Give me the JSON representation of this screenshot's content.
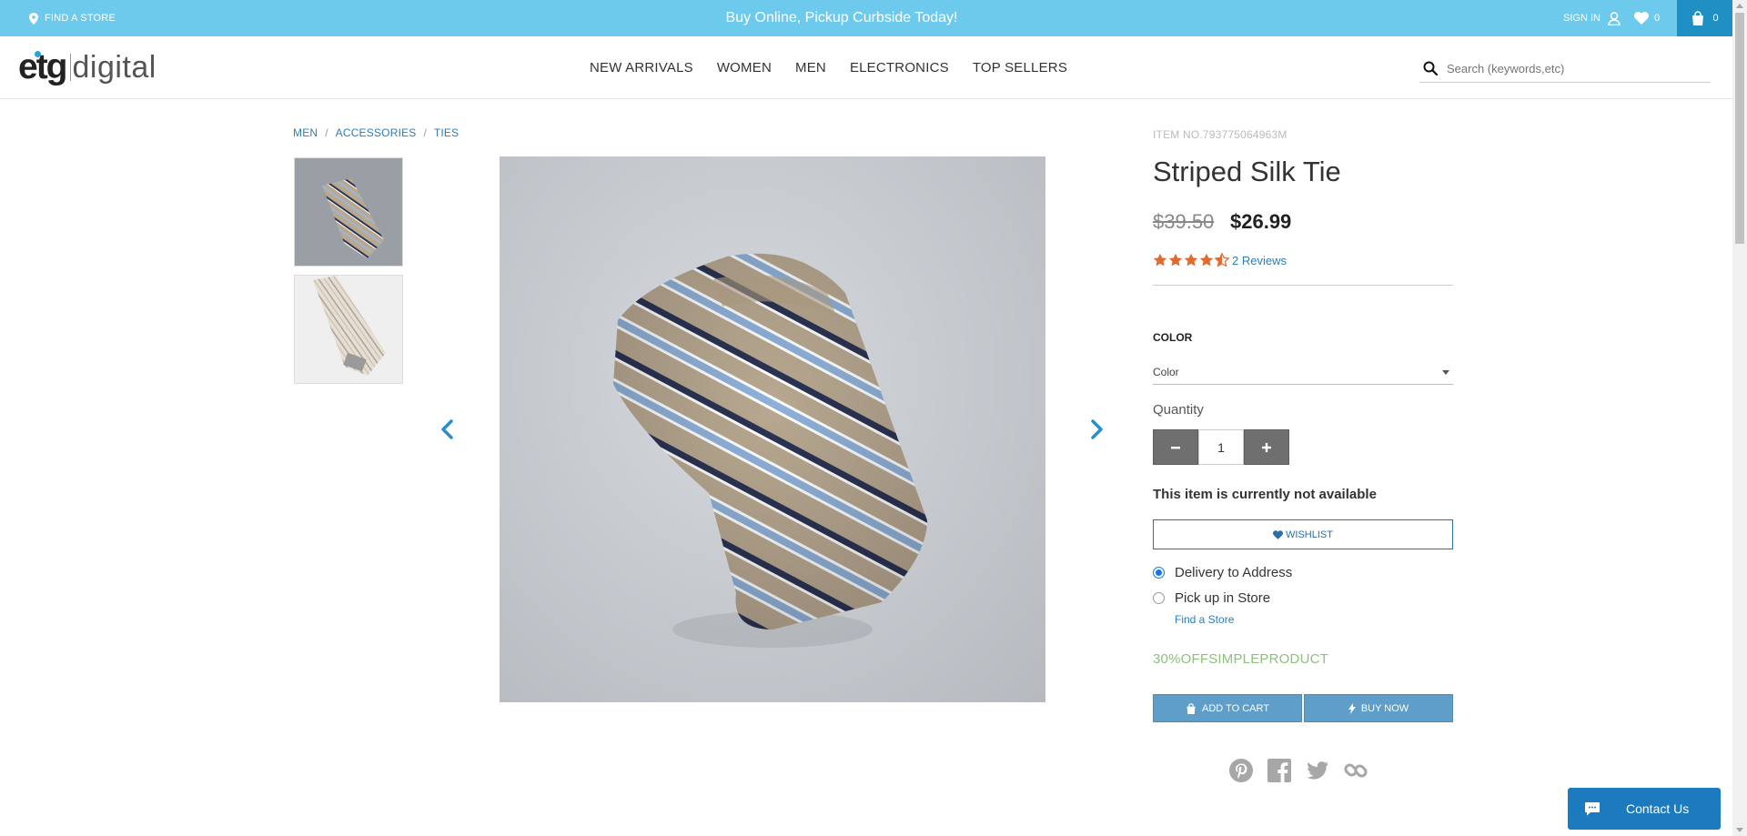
{
  "topbar": {
    "find_store": "FIND A STORE",
    "promo": "Buy Online, Pickup Curbside Today!",
    "sign_in": "SIGN IN",
    "wishlist_count": "0",
    "cart_count": "0",
    "bg_color": "#6ecaec",
    "cart_bg_color": "#1f8fc4"
  },
  "header": {
    "logo_left": "etg",
    "logo_right": "digital",
    "nav": [
      "NEW ARRIVALS",
      "WOMEN",
      "MEN",
      "ELECTRONICS",
      "TOP SELLERS"
    ],
    "search_placeholder": "Search (keywords,etc)"
  },
  "breadcrumb": [
    "MEN",
    "ACCESSORIES",
    "TIES"
  ],
  "product": {
    "item_no": "ITEM NO.793775064963M",
    "title": "Striped Silk Tie",
    "price_old": "$39.50",
    "price_new": "$26.99",
    "rating": 4.5,
    "reviews": "2 Reviews",
    "color_label": "COLOR",
    "color_value": "Color",
    "quantity_label": "Quantity",
    "quantity": "1",
    "availability": "This item is currently not available",
    "wishlist": "WISHLIST",
    "delivery_options": [
      {
        "label": "Delivery to Address",
        "selected": true
      },
      {
        "label": "Pick up in Store",
        "selected": false
      }
    ],
    "find_a_store": "Find a Store",
    "promo_code": "30%OFFSIMPLEPRODUCT",
    "add_to_cart": "ADD TO CART",
    "buy_now": "BUY NOW"
  },
  "social_icons": [
    "pinterest-icon",
    "facebook-icon",
    "twitter-icon",
    "link-icon"
  ],
  "contact_us": "Contact Us",
  "colors": {
    "accent_link": "#2a7db8",
    "star": "#e06a2f",
    "promo_code": "#8ec07c",
    "action_button": "#5e9ec8"
  }
}
